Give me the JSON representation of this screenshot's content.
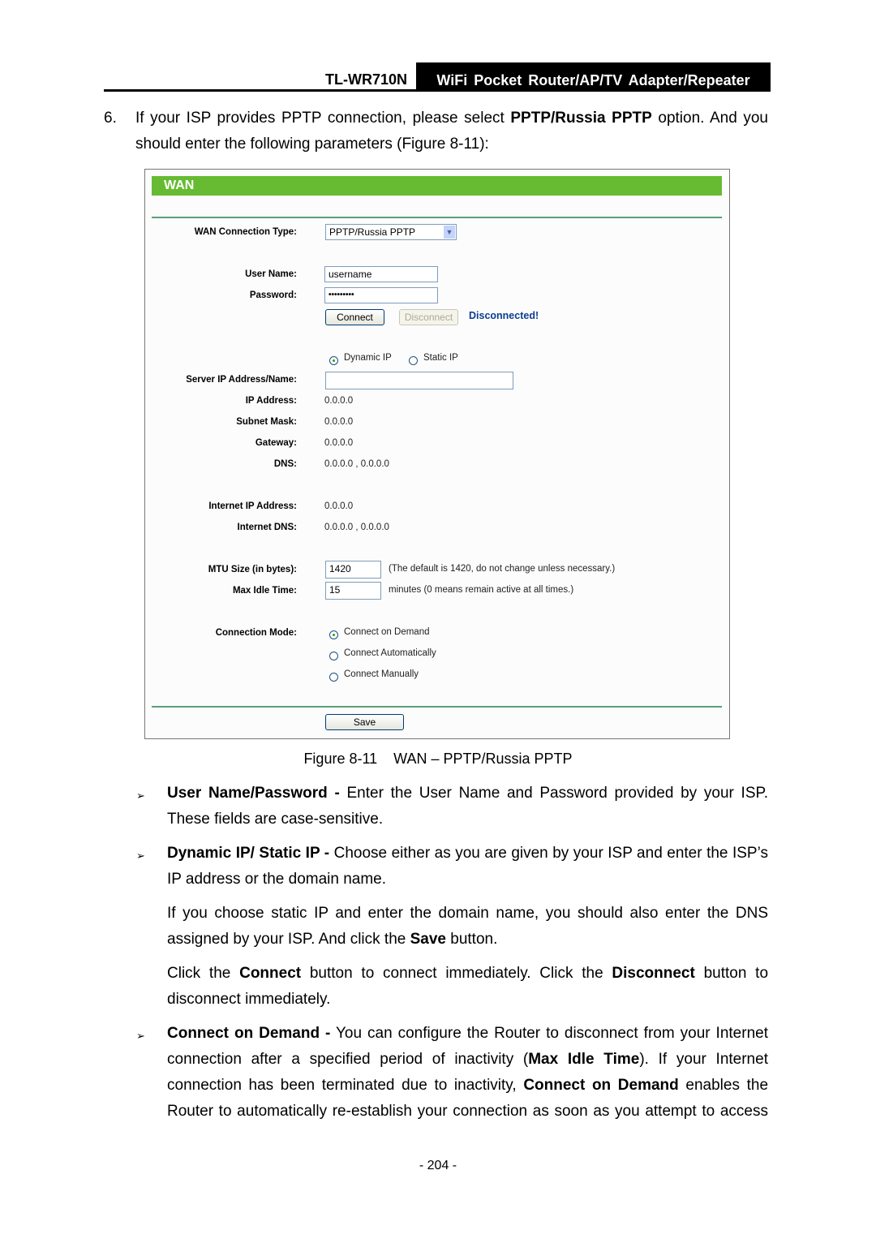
{
  "header": {
    "model": "TL-WR710N",
    "product": "WiFi Pocket Router/AP/TV Adapter/Repeater"
  },
  "intro": {
    "number": "6.",
    "text_before": "If your ISP provides PPTP connection, please select ",
    "bold": "PPTP/Russia PPTP",
    "text_after": " option. And you should enter the following parameters (Figure 8-11):"
  },
  "figure": {
    "title": "WAN",
    "wan_type_label": "WAN Connection Type:",
    "wan_type_value": "PPTP/Russia PPTP",
    "username_label": "User Name:",
    "username_value": "username",
    "password_label": "Password:",
    "password_value": "•••••••••",
    "connect_label": "Connect",
    "disconnect_label": "Disconnect",
    "status": "Disconnected!",
    "status_color": "#0b3d91",
    "dynamic_ip": "Dynamic IP",
    "static_ip": "Static IP",
    "ip_mode_selected": "Dynamic IP",
    "server_label": "Server IP Address/Name:",
    "server_value": "",
    "rows": [
      {
        "label": "IP Address:",
        "value": "0.0.0.0"
      },
      {
        "label": "Subnet Mask:",
        "value": "0.0.0.0"
      },
      {
        "label": "Gateway:",
        "value": "0.0.0.0"
      },
      {
        "label": "DNS:",
        "value": "0.0.0.0 , 0.0.0.0"
      },
      {
        "label": "Internet IP Address:",
        "value": "0.0.0.0"
      },
      {
        "label": "Internet DNS:",
        "value": "0.0.0.0 , 0.0.0.0"
      }
    ],
    "mtu_label": "MTU Size (in bytes):",
    "mtu_value": "1420",
    "mtu_hint": "(The default is 1420, do not change unless necessary.)",
    "idle_label": "Max Idle Time:",
    "idle_value": "15",
    "idle_hint": "minutes (0 means remain active at all times.)",
    "mode_label": "Connection Mode:",
    "modes": [
      "Connect on Demand",
      "Connect Automatically",
      "Connect Manually"
    ],
    "mode_selected": "Connect on Demand",
    "save_label": "Save",
    "accent": "#66bb33"
  },
  "caption": "Figure 8-11    WAN – PPTP/Russia PPTP",
  "bullets": [
    {
      "bold": "User Name/Password -",
      "text": " Enter the User Name and Password provided by your ISP. These fields are case-sensitive."
    },
    {
      "bold": "Dynamic IP/ Static IP -",
      "text": " Choose either as you are given by your ISP and enter the ISP’s IP address or the domain name."
    },
    {
      "bold": "Connect on Demand -",
      "text": " You can configure the Router to disconnect from your Internet connection after a specified period of inactivity (",
      "bold2": "Max Idle Time",
      "text2": "). If your Internet connection has been terminated due to inactivity, ",
      "bold3": "Connect on Demand",
      "text3": " enables the Router to automatically re-establish your connection as soon as you attempt to access"
    }
  ],
  "para_static": {
    "t1": "If you choose static IP and enter the domain name, you should also enter the DNS assigned by your ISP. And click the ",
    "b1": "Save",
    "t2": " button."
  },
  "para_click": {
    "t1": "Click the ",
    "b1": "Connect",
    "t2": " button to connect immediately. Click the ",
    "b2": "Disconnect",
    "t3": " button to disconnect immediately."
  },
  "page_number": "- 204 -"
}
